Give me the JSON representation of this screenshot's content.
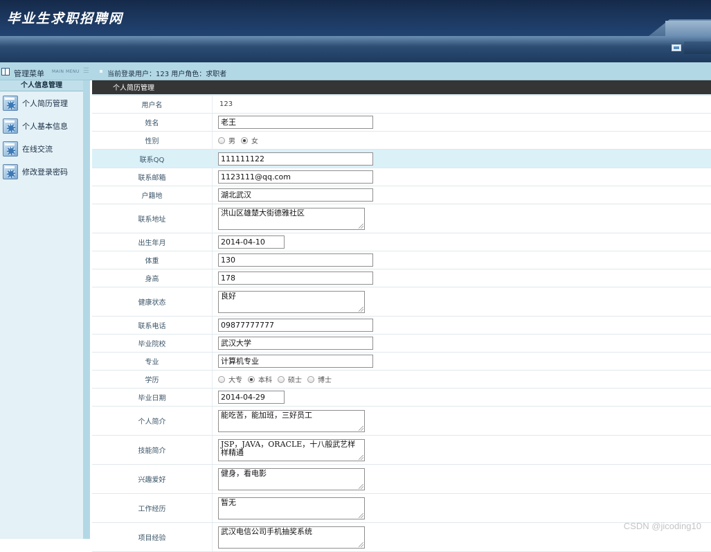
{
  "header": {
    "logo": "毕业生求职招聘网"
  },
  "statusbar": {
    "menu_title": "管理菜单",
    "menu_sub": "MAIN MENU",
    "user_info": "当前登录用户：123  用户角色：求职者"
  },
  "sidebar": {
    "heading": "个人信息管理",
    "items": [
      {
        "label": "个人简历管理",
        "icon": "settings-icon"
      },
      {
        "label": "个人基本信息",
        "icon": "settings-icon"
      },
      {
        "label": "在线交流",
        "icon": "settings-icon"
      },
      {
        "label": "修改登录密码",
        "icon": "settings-icon"
      }
    ]
  },
  "main": {
    "title": "个人简历管理",
    "fields": {
      "username": {
        "label": "用户名",
        "value": "123"
      },
      "name": {
        "label": "姓名",
        "value": "老王"
      },
      "gender": {
        "label": "性别",
        "options": [
          "男",
          "女"
        ],
        "selected": "女"
      },
      "qq": {
        "label": "联系QQ",
        "value": "111111122"
      },
      "email": {
        "label": "联系邮箱",
        "value": "1123111@qq.com"
      },
      "hometown": {
        "label": "户籍地",
        "value": "湖北武汉"
      },
      "address": {
        "label": "联系地址",
        "value": "洪山区雄楚大街德雅社区"
      },
      "birth": {
        "label": "出生年月",
        "value": "2014-04-10"
      },
      "weight": {
        "label": "体重",
        "value": "130"
      },
      "height": {
        "label": "身高",
        "value": "178"
      },
      "health": {
        "label": "健康状态",
        "value": "良好"
      },
      "phone": {
        "label": "联系电话",
        "value": "09877777777"
      },
      "school": {
        "label": "毕业院校",
        "value": "武汉大学"
      },
      "major": {
        "label": "专业",
        "value": "计算机专业"
      },
      "degree": {
        "label": "学历",
        "options": [
          "大专",
          "本科",
          "硕士",
          "博士"
        ],
        "selected": "本科"
      },
      "grad_date": {
        "label": "毕业日期",
        "value": "2014-04-29"
      },
      "intro": {
        "label": "个人简介",
        "value": "能吃苦，能加班，三好员工"
      },
      "skills": {
        "label": "技能简介",
        "value": "JSP，JAVA，ORACLE，十八般武艺样样精通"
      },
      "hobbies": {
        "label": "兴趣爱好",
        "value": "健身，看电影"
      },
      "work": {
        "label": "工作经历",
        "value": "暂无"
      },
      "project": {
        "label": "项目经验",
        "value": "武汉电信公司手机抽奖系统"
      }
    }
  },
  "watermark": "CSDN @jicoding10"
}
